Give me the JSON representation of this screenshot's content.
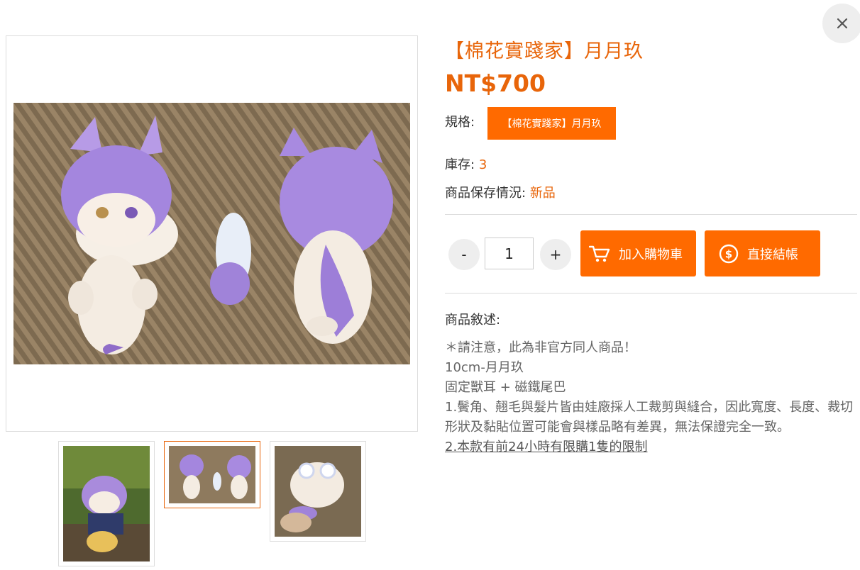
{
  "product": {
    "title": "【棉花實踐家】月月玖",
    "price": "NT$700",
    "spec_label": "規格:",
    "spec_option": "【棉花實踐家】月月玖",
    "stock_label": "庫存:",
    "stock_value": "3",
    "condition_label": "商品保存情況:",
    "condition_value": "新品"
  },
  "purchase": {
    "minus_label": "-",
    "quantity": "1",
    "plus_label": "+",
    "add_to_cart_label": "加入購物車",
    "checkout_label": "直接結帳"
  },
  "description": {
    "label": "商品敘述:",
    "lines": [
      "＊請注意，此為非官方同人商品！",
      "10cm-月月玖",
      "固定獸耳 + 磁鐵尾巴",
      "1.鬢角、翹毛與髮片皆由娃廠採人工裁剪與縫合，因此寬度、長度、裁切形狀及黏貼位置可能會與樣品略有差異，無法保證完全一致。"
    ],
    "link_text": "2.本款有前24小時有限購1隻的限制"
  },
  "icons": {
    "close": "close-icon",
    "cart": "cart-icon",
    "dollar": "dollar-coin-icon"
  },
  "colors": {
    "accent": "#e8650a",
    "button": "#ff6a00",
    "plush_purple": "#9b7fd6"
  },
  "thumbnails": {
    "active_index": 1,
    "count": 3
  }
}
